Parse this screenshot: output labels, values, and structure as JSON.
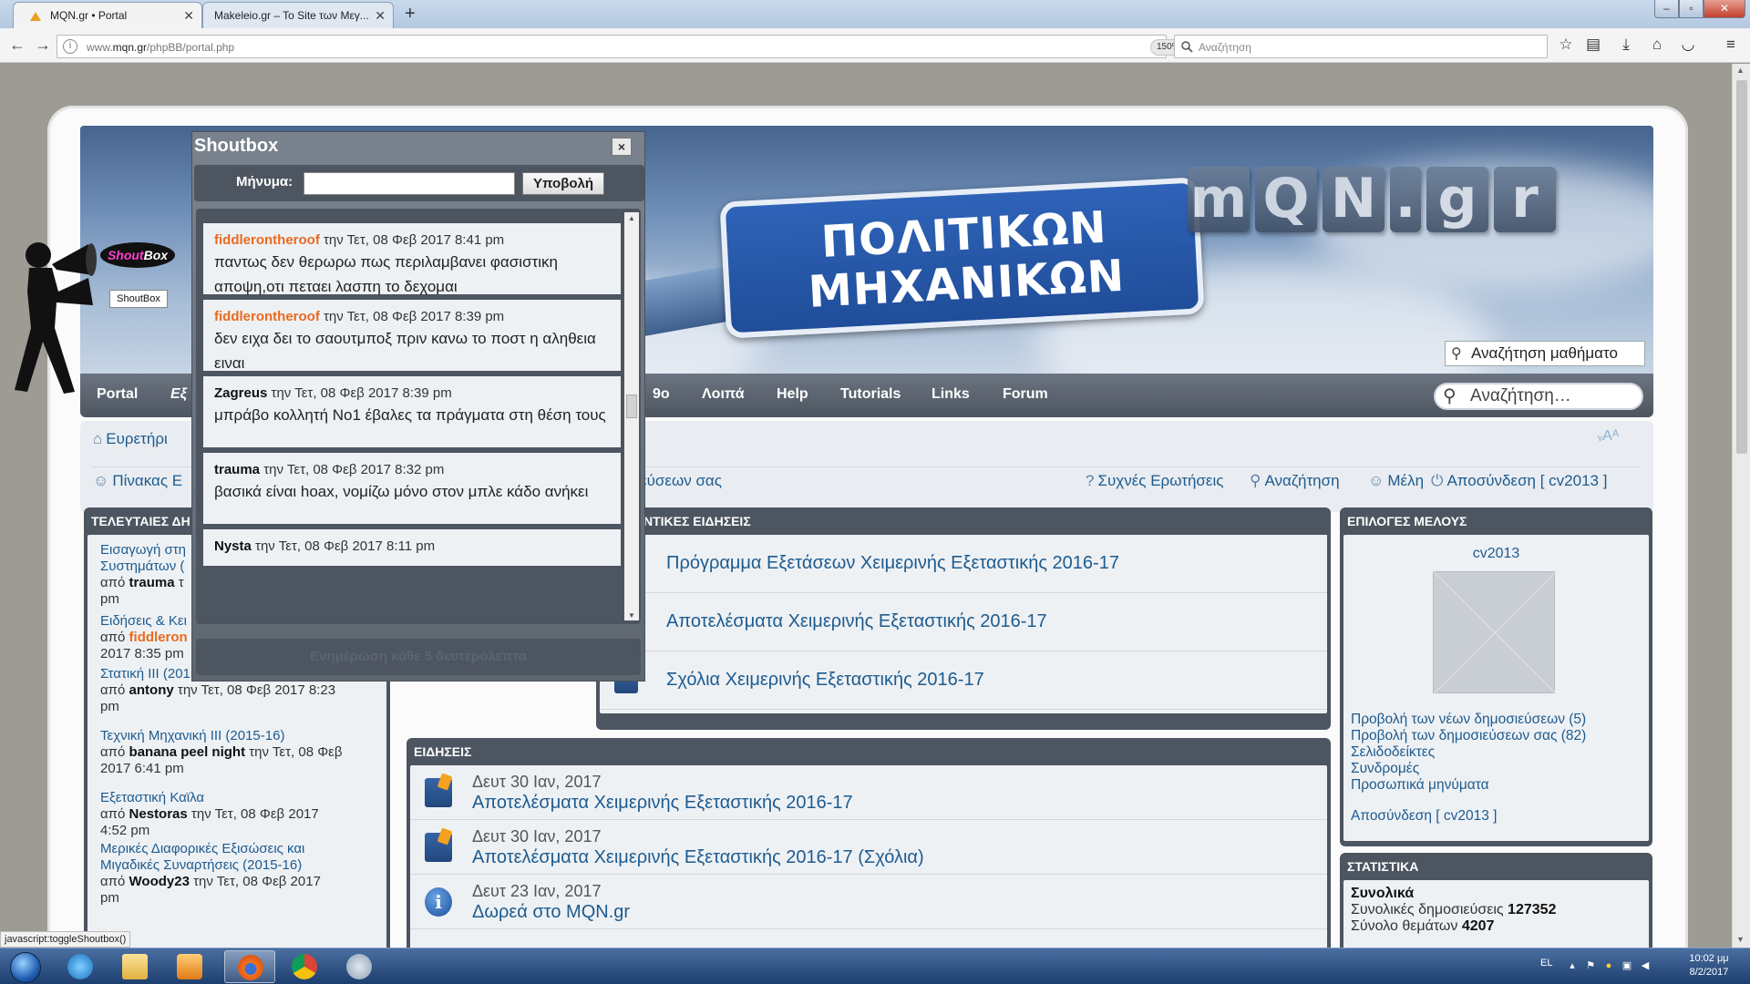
{
  "browser": {
    "tabs": [
      {
        "title": "MQN.gr • Portal",
        "active": true
      },
      {
        "title": "Makeleio.gr – To Site των Μεγ...",
        "active": false
      }
    ],
    "url_prefix": "www.",
    "url_domain": "mqn.gr",
    "url_path": "/phpBB/portal.php",
    "zoom": "150%",
    "search_placeholder": "Αναζήτηση"
  },
  "shoutbox": {
    "logo_a": "Shout",
    "logo_b": "Box",
    "launcher_label": "ShoutBox",
    "title": "Shoutbox",
    "close": "×",
    "message_label": "Μήνυμα:",
    "submit_label": "Υποβολή",
    "footer": "Ενημέρωση κάθε 5 δευτερόλεπτα",
    "messages": [
      {
        "user": "fiddlerontheroof",
        "highlight": true,
        "meta": "την Τετ, 08 Φεβ 2017 8:41 pm",
        "text": "παντως δεν θερωρω πως περιλαμβανει φασιστικη αποψη,οτι πεταει λασπη το δεχομαι"
      },
      {
        "user": "fiddlerontheroof",
        "highlight": true,
        "meta": "την Τετ, 08 Φεβ 2017 8:39 pm",
        "text": "δεν ειχα δει το σαουτμποξ πριν κανω το ποστ η αληθεια ειναι"
      },
      {
        "user": "Zagreus",
        "highlight": false,
        "meta": "την Τετ, 08 Φεβ 2017 8:39 pm",
        "text": "μπράβο κολλητή Νο1 έβαλες τα πράγματα στη θέση τους"
      },
      {
        "user": "trauma",
        "highlight": false,
        "meta": "την Τετ, 08 Φεβ 2017 8:32 pm",
        "text": "βασικά είναι hoax, νομίζω μόνο στον μπλε κάδο ανήκει"
      },
      {
        "user": "Nysta",
        "highlight": false,
        "meta": "την Τετ, 08 Φεβ 2017 8:11 pm",
        "text": ""
      }
    ]
  },
  "banner": {
    "sign_line1": "ΠΟΛΙΤΙΚΩΝ",
    "sign_line2": "ΜΗΧΑΝΙΚΩΝ",
    "logo_chars": [
      "m",
      "Q",
      "N",
      ".",
      "g",
      "r"
    ],
    "course_search": "Αναζήτηση μαθήματο"
  },
  "menu": {
    "items": [
      "Portal",
      "Εξ",
      "9ο",
      "Λοιπά",
      "Help",
      "Tutorials",
      "Links",
      "Forum"
    ],
    "search_placeholder": "Αναζήτηση…"
  },
  "crumbs": {
    "index": "Ευρετήρι",
    "board": "Πίνακας Ε",
    "own_posts_tail": "εύσεων σας",
    "font_ctrl": "ᵥAᴬ",
    "faq": "Συχνές Ερωτήσεις",
    "search": "Αναζήτηση",
    "members": "Μέλη",
    "logout": "Αποσύνδεση [ cv2013 ]"
  },
  "left_panel": {
    "title": "ΤΕΛΕΥΤΑΙΕΣ ΔΗ",
    "items": [
      {
        "title_l1": "Εισαγωγή στη",
        "title_l2": "Συστημάτων (",
        "by": "από",
        "user": "trauma",
        "highlight": false,
        "meta_tail": "τ",
        "meta_l2": "pm"
      },
      {
        "title_l1": "Ειδήσεις & Κει",
        "by": "από",
        "user": "fiddleron",
        "highlight": true,
        "meta_l2": "2017 8:35 pm"
      },
      {
        "title_l1": "Στατική ΙΙΙ (2015-16)",
        "by": "από",
        "user": "antony",
        "highlight": false,
        "meta_tail": "την Τετ, 08 Φεβ 2017 8:23",
        "meta_l2": "pm"
      },
      {
        "title_l1": "Τεχνική Μηχανική ΙΙΙ (2015-16)",
        "by": "από",
        "user": "banana peel night",
        "highlight": false,
        "meta_tail": "την Τετ, 08 Φεβ",
        "meta_l2": "2017 6:41 pm"
      },
      {
        "title_l1": "Εξεταστική Καϊλα",
        "by": "από",
        "user": "Nestoras",
        "highlight": false,
        "meta_tail": "την Τετ, 08 Φεβ 2017",
        "meta_l2": "4:52 pm"
      },
      {
        "title_l1": "Μερικές Διαφορικές Εξισώσεις και",
        "title_l2": "Μιγαδικές Συναρτήσεις (2015-16)",
        "by": "από",
        "user": "Woody23",
        "highlight": false,
        "meta_tail": "την Τετ, 08 Φεβ 2017",
        "meta_l2": "pm"
      }
    ]
  },
  "important": {
    "title": "ΝΤΙΚΕΣ ΕΙΔΗΣΕΙΣ",
    "items": [
      "Πρόγραμμα Εξετάσεων Χειμερινής Εξεταστικής 2016-17",
      "Αποτελέσματα Χειμερινής Εξεταστικής 2016-17",
      "Σχόλια Χειμερινής Εξεταστικής 2016-17"
    ]
  },
  "news": {
    "title": "ΕΙΔΗΣΕΙΣ",
    "items": [
      {
        "date": "Δευτ 30 Ιαν, 2017",
        "title": "Αποτελέσματα Χειμερινής Εξεταστικής 2016-17",
        "icon": "news"
      },
      {
        "date": "Δευτ 30 Ιαν, 2017",
        "title": "Αποτελέσματα Χειμερινής Εξεταστικής 2016-17 (Σχόλια)",
        "icon": "news"
      },
      {
        "date": "Δευτ 23 Ιαν, 2017",
        "title": "Δωρεά στο MQN.gr",
        "icon": "info"
      }
    ]
  },
  "user_panel": {
    "title": "ΕΠΙΛΟΓΕΣ ΜΕΛΟΥΣ",
    "username": "cv2013",
    "links": [
      "Προβολή των νέων δημοσιεύσεων (5)",
      "Προβολή των δημοσιεύσεων σας (82)",
      "Σελιδοδείκτες",
      "Συνδρομές",
      "Προσωπικά μηνύματα"
    ],
    "logout": "Αποσύνδεση [ cv2013 ]"
  },
  "stats": {
    "title": "ΣΤΑΤΙΣΤΙΚΑ",
    "heading": "Συνολικά",
    "posts_label": "Συνολικές δημοσιεύσεις",
    "posts_value": "127352",
    "topics_label": "Σύνολο θεμάτων",
    "topics_value": "4207"
  },
  "status_text": "javascript:toggleShoutbox()",
  "taskbar": {
    "lang": "EL",
    "time": "10:02 μμ",
    "date": "8/2/2017"
  }
}
